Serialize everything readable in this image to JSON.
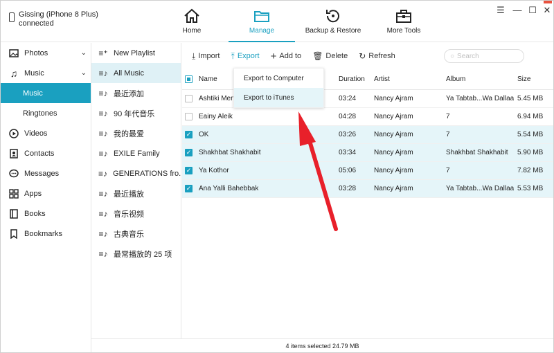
{
  "device": {
    "name": "Gissing (iPhone 8 Plus)",
    "status": "connected"
  },
  "nav_tabs": [
    {
      "label": "Home",
      "icon": "home-icon"
    },
    {
      "label": "Manage",
      "icon": "folder-icon"
    },
    {
      "label": "Backup & Restore",
      "icon": "restore-icon"
    },
    {
      "label": "More Tools",
      "icon": "toolbox-icon"
    }
  ],
  "sidebar": {
    "items": [
      {
        "label": "Photos",
        "icon": "photos-icon"
      },
      {
        "label": "Music",
        "icon": "music-icon"
      },
      {
        "label": "Music"
      },
      {
        "label": "Ringtones"
      },
      {
        "label": "Videos",
        "icon": "play-icon"
      },
      {
        "label": "Contacts",
        "icon": "contacts-icon"
      },
      {
        "label": "Messages",
        "icon": "messages-icon"
      },
      {
        "label": "Apps",
        "icon": "apps-icon"
      },
      {
        "label": "Books",
        "icon": "books-icon"
      },
      {
        "label": "Bookmarks",
        "icon": "bookmark-icon"
      }
    ]
  },
  "playlists": {
    "new_label": "New Playlist",
    "items": [
      "All Music",
      "最近添加",
      "90 年代音乐",
      "我的最爱",
      "EXILE Family",
      "GENERATIONS fro...",
      "最近播放",
      "音乐视频",
      "古典音乐",
      "最常播放的 25 项"
    ]
  },
  "toolbar": {
    "import": "Import",
    "export": "Export",
    "add": "Add to",
    "delete": "Delete",
    "refresh": "Refresh",
    "search_placeholder": "Search"
  },
  "export_menu": [
    "Export to Computer",
    "Export to iTunes"
  ],
  "table": {
    "headers": {
      "name": "Name",
      "duration": "Duration",
      "artist": "Artist",
      "album": "Album",
      "size": "Size"
    },
    "rows": [
      {
        "name": "Ashtiki Men",
        "duration": "03:24",
        "artist": "Nancy Ajram",
        "album": "Ya Tabtab...Wa Dallaa",
        "size": "5.45 MB",
        "checked": false
      },
      {
        "name": "Eainy Aleik",
        "duration": "04:28",
        "artist": "Nancy Ajram",
        "album": "7",
        "size": "6.94 MB",
        "checked": false
      },
      {
        "name": "OK",
        "duration": "03:26",
        "artist": "Nancy Ajram",
        "album": "7",
        "size": "5.54 MB",
        "checked": true
      },
      {
        "name": "Shakhbat Shakhabit",
        "duration": "03:34",
        "artist": "Nancy Ajram",
        "album": "Shakhbat Shakhabit",
        "size": "5.90 MB",
        "checked": true
      },
      {
        "name": "Ya Kothor",
        "duration": "05:06",
        "artist": "Nancy Ajram",
        "album": "7",
        "size": "7.82 MB",
        "checked": true
      },
      {
        "name": "Ana Yalli Bahebbak",
        "duration": "03:28",
        "artist": "Nancy Ajram",
        "album": "Ya Tabtab...Wa Dallaa",
        "size": "5.53 MB",
        "checked": true
      }
    ]
  },
  "status_text": "4 items selected 24.79 MB",
  "colors": {
    "accent": "#1aa0c0",
    "selection": "#e5f5f9",
    "arrow": "#e8202a"
  }
}
